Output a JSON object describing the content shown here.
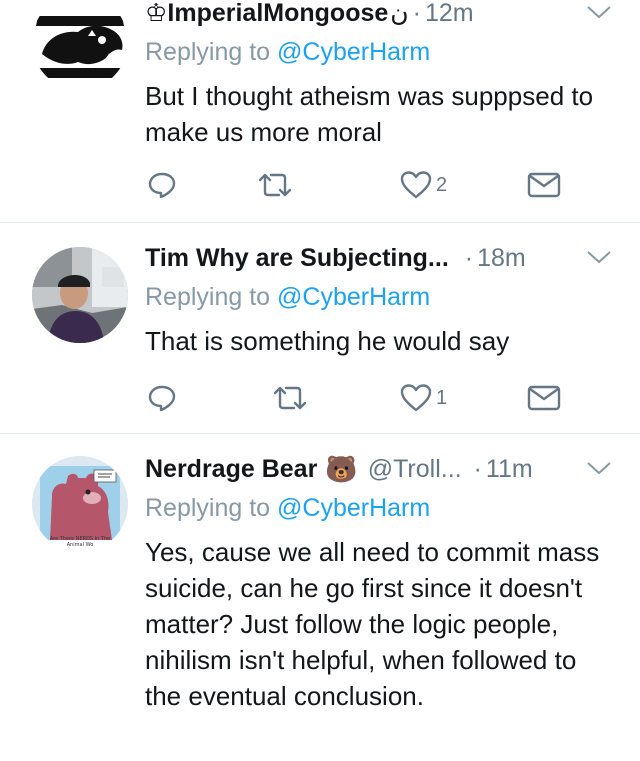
{
  "tweets": [
    {
      "name": "♔ImperialMongoose",
      "name_suffix": "ن",
      "handle": "",
      "sep": "·",
      "time": "12m",
      "reply_prefix": "Replying to ",
      "reply_to": "@CyberHarm",
      "text": "But I thought atheism was supppsed to make us more moral",
      "likes": "2",
      "avatar": "black-panther-logo"
    },
    {
      "name": "Tim Why are Subjecting...",
      "handle": "",
      "sep": "·",
      "time": "18m",
      "reply_prefix": "Replying to ",
      "reply_to": "@CyberHarm",
      "text": "That is something he would say",
      "likes": "1",
      "avatar": "man-in-car-photo"
    },
    {
      "name": "Nerdrage Bear",
      "emoji": "🐻",
      "handle": "@Troll...",
      "sep": "·",
      "time": "11m",
      "reply_prefix": "Replying to ",
      "reply_to": "@CyberHarm",
      "text": "Yes, cause we all need to commit mass suicide, can he go first since it doesn't matter? Just follow the logic people, nihilism isn't helpful, when followed to the eventual conclusion.",
      "avatar": "cartoon-bear-drawing",
      "avatar_caption": "Are There NERDS In The Animal Wo"
    }
  ],
  "colors": {
    "link": "#1da1f2",
    "muted": "#657786",
    "divider": "#e1e8ed"
  }
}
